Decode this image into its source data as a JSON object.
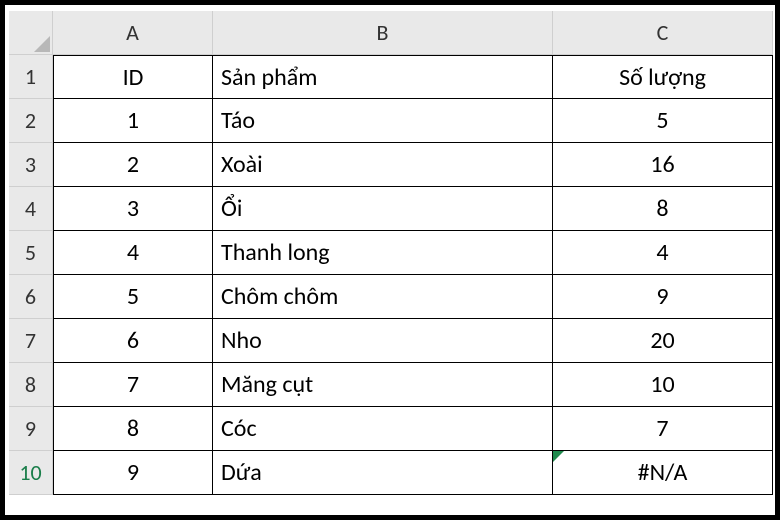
{
  "columns": [
    "A",
    "B",
    "C"
  ],
  "row_numbers": [
    "1",
    "2",
    "3",
    "4",
    "5",
    "6",
    "7",
    "8",
    "9",
    "10"
  ],
  "selected_row_index": 9,
  "headers": {
    "A": "ID",
    "B": "Sản phẩm",
    "C": "Số lượng"
  },
  "rows": [
    {
      "A": "1",
      "B": "Táo",
      "C": "5"
    },
    {
      "A": "2",
      "B": "Xoài",
      "C": "16"
    },
    {
      "A": "3",
      "B": "Ổi",
      "C": "8"
    },
    {
      "A": "4",
      "B": "Thanh long",
      "C": "4"
    },
    {
      "A": "5",
      "B": "Chôm chôm",
      "C": "9"
    },
    {
      "A": "6",
      "B": "Nho",
      "C": "20"
    },
    {
      "A": "7",
      "B": "Măng cụt",
      "C": "10"
    },
    {
      "A": "8",
      "B": "Cóc",
      "C": "7"
    },
    {
      "A": "9",
      "B": "Dứa",
      "C": "#N/A"
    }
  ],
  "error_cells": [
    "C10"
  ],
  "chart_data": {
    "type": "table",
    "title": "",
    "columns": [
      "ID",
      "Sản phẩm",
      "Số lượng"
    ],
    "data": [
      [
        1,
        "Táo",
        5
      ],
      [
        2,
        "Xoài",
        16
      ],
      [
        3,
        "Ổi",
        8
      ],
      [
        4,
        "Thanh long",
        4
      ],
      [
        5,
        "Chôm chôm",
        9
      ],
      [
        6,
        "Nho",
        20
      ],
      [
        7,
        "Măng cụt",
        10
      ],
      [
        8,
        "Cóc",
        7
      ],
      [
        9,
        "Dứa",
        "#N/A"
      ]
    ]
  }
}
